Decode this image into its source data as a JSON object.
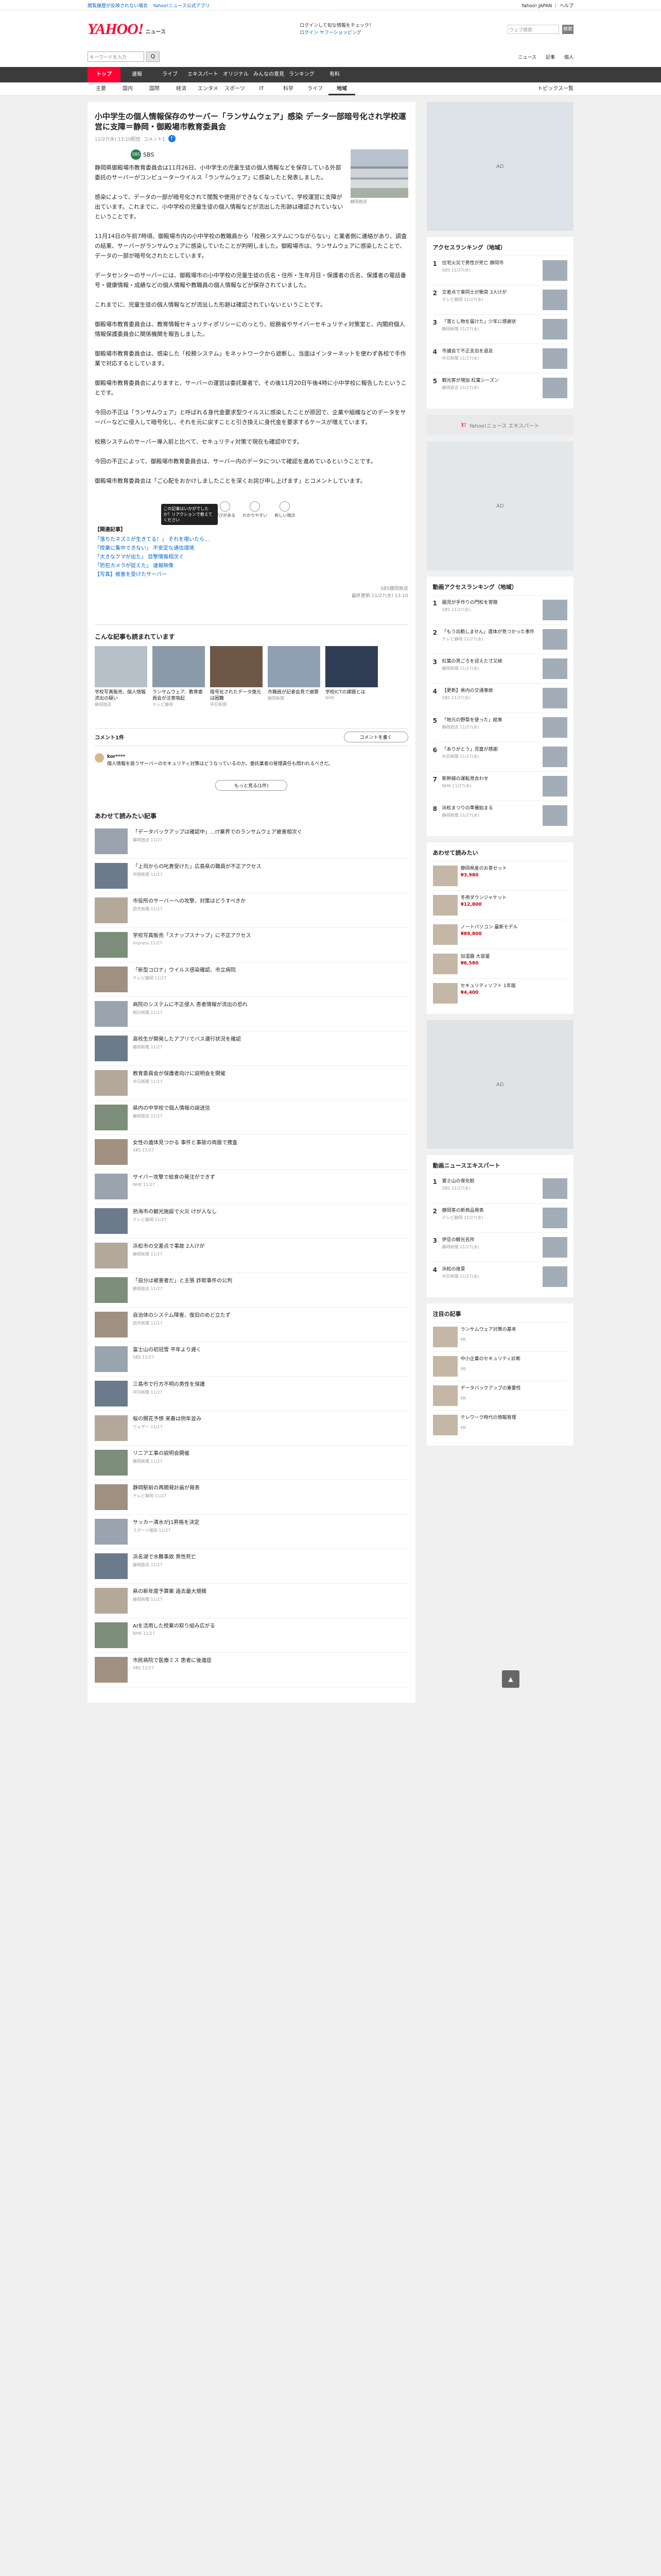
{
  "topbar": {
    "left1": "閲覧履歴が反映されない場合",
    "left2": "Yahoo!ニュース公式アプリ",
    "right1": "Yahoo! JAPAN",
    "right2": "ヘルプ"
  },
  "header": {
    "logo": "YAHOO!",
    "logo_sub": "JAPAN",
    "logo_news": "ニュース",
    "line1": "ログインして旬な情報をチェック！",
    "line2": "ログイン ヤフーショッピング",
    "search_placeholder": "ウェブ検索",
    "search_go": "検索"
  },
  "searchbar": {
    "placeholder": "キーワードを入力",
    "btn": "Q",
    "r1": "ニュース",
    "r2": "記事",
    "r3": "個人"
  },
  "nav1": [
    "トップ",
    "速報",
    "ライブ",
    "エキスパート",
    "オリジナル",
    "みんなの意見",
    "ランキング",
    "有料"
  ],
  "nav2": [
    "主要",
    "国内",
    "国際",
    "経済",
    "エンタメ",
    "スポーツ",
    "IT",
    "科学",
    "ライフ",
    "地域"
  ],
  "nav2_right": "トピックス一覧",
  "article": {
    "title": "小中学生の個人情報保存のサーバー「ランサムウェア」感染 データ一部暗号化され学校運営に支障＝静岡・御殿場市教育委員会",
    "date": "11/27(水) 13:10配信",
    "comments": "コメント1",
    "source": "SBS",
    "photo_caption": "静岡放送",
    "paragraphs": [
      "静岡県御殿場市教育委員会は11月26日、小中学生の児童生徒の個人情報などを保存している外部委託のサーバーがコンピューターウイルス「ランサムウェア」に感染したと発表しました。",
      "感染によって、データの一部が暗号化されて閲覧や使用ができなくなっていて、学校運営に支障が出ています。これまでに、小中学校の児童生徒の個人情報などが流出した形跡は確認されていないということです。",
      "11月14日の午前7時頃、御殿場市内の小中学校の教職員から「校務システムにつながらない」と業者側に連絡があり、調査の結果、サーバーがランサムウェアに感染していたことが判明しました。御殿場市は、ランサムウェアに感染したことで、データの一部が暗号化されたとしています。",
      "データセンターのサーバーには、御殿場市の小中学校の児童生徒の氏名・住所・生年月日・保護者の氏名、保護者の電話番号・健康情報・成績などの個人情報や教職員の個人情報などが保存されていました。",
      "これまでに、児童生徒の個人情報などが流出した形跡は確認されていないということです。",
      "御殿場市教育委員会は、教育情報セキュリティポリシーにのっとり、総務省やサイバーセキュリティ対策室と、内閣府個人情報保護委員会に関係機関を報告しました。",
      "御殿場市教育委員会は、感染した「校務システム」をネットワークから遮断し、当面はインターネットを使わず各校で手作業で対応するとしています。",
      "御殿場市教育委員会によりますと、サーバーの運営は委託業者で、その後11月20日午後4時に小中学校に報告したということです。",
      "今回の不正は「ランサムウェア」と呼ばれる身代金要求型ウイルスに感染したことが原因で、企業や組織などのデータをサーバーなどに侵入して暗号化し、それを元に戻すことと引き換えに身代金を要求するケースが増えています。",
      "校務システムのサーバー導入前と比べて、セキュリティ対策で現在も確認中です。",
      "今回の不正によって、御殿場市教育委員会は、サーバー内のデータについて確認を進めているということです。",
      "御殿場市教育委員会は「ご心配をおかけしましたことを深くお詫び申し上げます」とコメントしています。"
    ],
    "tooltip": "この記事はいかがでしたか？リアクションで教えてください",
    "reactions": [
      "学びがある",
      "わかりやすい",
      "新しい視点"
    ],
    "related_title": "【関連記事】",
    "related": [
      "「落ちたネズミが生きてる！」 それを覗いたら…",
      "「授業に集中できない」 不安定な通信環境",
      "「大きなクマが出た」 目撃情報相次ぐ",
      "「防犯カメラが捉えた」 速報映像",
      "【写真】被害を受けたサーバー"
    ],
    "updated": "最終更新:11/27(水) 13:10",
    "source_footer": "SBS静岡放送"
  },
  "also": {
    "title": "こんな記事も読まれています",
    "items": [
      {
        "t": "学校写真販売、個人情報流出の疑い",
        "s": "静岡放送"
      },
      {
        "t": "ランサムウェア、教育委員会が注意喚起",
        "s": "テレビ静岡"
      },
      {
        "t": "暗号化されたデータ復元は困難",
        "s": "中日新聞"
      },
      {
        "t": "市職員が記者会見で謝罪",
        "s": "静岡新聞"
      },
      {
        "t": "学校ICTの課題とは",
        "s": "NHK"
      }
    ]
  },
  "comment": {
    "label": "コメント1件",
    "write": "コメントを書く",
    "user": "kor****",
    "text": "個人情報を扱うサーバーのセキュリティ対策はどうなっているのか。委託業者の管理責任も問われるべきだ。",
    "more": "もっと見る(1件)"
  },
  "topics": {
    "title": "あわせて読みたい記事",
    "items": [
      {
        "t": "「データバックアップは確認中」…IT業界でのランサムウェア被害相次ぐ",
        "s": "静岡放送 11/27"
      },
      {
        "t": "「上司からの叱責受けた」広島県の職員が不正アクセス",
        "s": "中国新聞 11/27"
      },
      {
        "t": "市役所のサーバーへの攻撃、対策はどうすべきか",
        "s": "読売新聞 11/27"
      },
      {
        "t": "学校写真販売「スナップスナップ」に不正アクセス",
        "s": "Impress 11/27"
      },
      {
        "t": "「新型コロナ」ウイルス感染確認、市立病院",
        "s": "テレビ静岡 11/27"
      },
      {
        "t": "病院のシステムに不正侵入 患者情報が流出の恐れ",
        "s": "朝日新聞 11/27"
      },
      {
        "t": "高校生が開発したアプリでバス運行状況を確認",
        "s": "静岡新聞 11/27"
      },
      {
        "t": "教育委員会が保護者向けに説明会を開催",
        "s": "中日新聞 11/27"
      },
      {
        "t": "県内の中学校で個人情報の誤送信",
        "s": "静岡放送 11/27"
      },
      {
        "t": "女性の遺体見つかる 事件と事故の両面で捜査",
        "s": "SBS 11/27"
      },
      {
        "t": "サイバー攻撃で給食の発注ができず",
        "s": "NHK 11/27"
      },
      {
        "t": "熱海市の観光施設で火災 けが人なし",
        "s": "テレビ静岡 11/27"
      },
      {
        "t": "浜松市の交差点で事故 2人けが",
        "s": "静岡新聞 11/27"
      },
      {
        "t": "「自分は被害者だ」と主張 詐欺事件の公判",
        "s": "静岡放送 11/27"
      },
      {
        "t": "自治体のシステム障害、復旧のめど立たず",
        "s": "読売新聞 11/27"
      },
      {
        "t": "富士山の初冠雪 平年より遅く",
        "s": "SBS 11/27"
      },
      {
        "t": "三島市で行方不明の男性を保護",
        "s": "中日新聞 11/27"
      },
      {
        "t": "桜の開花予想 来春は例年並み",
        "s": "ウェザー 11/27"
      },
      {
        "t": "リニア工事の説明会開催",
        "s": "静岡新聞 11/27"
      },
      {
        "t": "静岡駅前の再開発計画が発表",
        "s": "テレビ静岡 11/27"
      },
      {
        "t": "サッカー清水がJ1昇格を決定",
        "s": "スポーツ報知 11/27"
      },
      {
        "t": "浜名湖で水難事故 男性死亡",
        "s": "静岡放送 11/27"
      },
      {
        "t": "県の新年度予算案 過去最大規模",
        "s": "静岡新聞 11/27"
      },
      {
        "t": "AIを活用した授業の取り組み広がる",
        "s": "NHK 11/27"
      },
      {
        "t": "市民病院で医療ミス 患者に後遺症",
        "s": "SBS 11/27"
      }
    ]
  },
  "side": {
    "access_title": "アクセスランキング（地域）",
    "access": [
      {
        "n": "1",
        "t": "住宅火災で男性が死亡 静岡市",
        "s": "SBS 11/27(水)"
      },
      {
        "n": "2",
        "t": "交差点で車同士が衝突 3人けが",
        "s": "テレビ静岡 11/27(水)"
      },
      {
        "n": "3",
        "t": "「落とし物を届けた」少年に感謝状",
        "s": "静岡新聞 11/27(水)"
      },
      {
        "n": "4",
        "t": "市議会で不正支出を追及",
        "s": "中日新聞 11/27(水)"
      },
      {
        "n": "5",
        "t": "観光客が増加 紅葉シーズン",
        "s": "静岡放送 11/27(水)"
      }
    ],
    "ad1": "Yahoo!ニュース エキスパート",
    "rank_title": "動画アクセスランキング（地域）",
    "rank": [
      {
        "n": "1",
        "t": "園児が手作りの門松を寄贈",
        "s": "SBS 11/27(水)"
      },
      {
        "n": "2",
        "t": "「もう出勤しません」遺体が見つかった事件",
        "s": "テレビ静岡 11/27(水)"
      },
      {
        "n": "3",
        "t": "紅葉の見ごろを迎えた寸又峡",
        "s": "静岡新聞 11/27(水)"
      },
      {
        "n": "4",
        "t": "【更新】県内の交通事故",
        "s": "SBS 11/27(水)"
      },
      {
        "n": "5",
        "t": "「地元の野菜を使った」給食",
        "s": "静岡放送 11/27(水)"
      },
      {
        "n": "6",
        "t": "「ありがとう」児童が感謝",
        "s": "中日新聞 11/27(水)"
      },
      {
        "n": "7",
        "t": "新幹線の運転見合わせ",
        "s": "NHK 11/27(水)"
      },
      {
        "n": "8",
        "t": "浜松まつりの準備始まる",
        "s": "静岡新聞 11/27(水)"
      }
    ],
    "shop_title": "あわせて読みたい",
    "shop": [
      {
        "t": "静岡県産のお茶セット",
        "p": "¥3,980"
      },
      {
        "t": "冬用ダウンジャケット",
        "p": "¥12,800"
      },
      {
        "t": "ノートパソコン 最新モデル",
        "p": "¥89,800"
      },
      {
        "t": "加湿器 大容量",
        "p": "¥6,580"
      },
      {
        "t": "セキュリティソフト 1年版",
        "p": "¥4,400"
      }
    ],
    "news_title": "動画ニュースエキスパート",
    "news": [
      {
        "n": "1",
        "t": "富士山の雪化粧",
        "s": "SBS 11/27(水)"
      },
      {
        "n": "2",
        "t": "静岡茶の新商品発表",
        "s": "テレビ静岡 11/27(水)"
      },
      {
        "n": "3",
        "t": "伊豆の観光名所",
        "s": "静岡新聞 11/27(水)"
      },
      {
        "n": "4",
        "t": "浜松の夜景",
        "s": "中日新聞 11/27(水)"
      }
    ],
    "pr_title": "注目の記事",
    "pr": [
      {
        "t": "ランサムウェア対策の基本",
        "s": "PR"
      },
      {
        "t": "中小企業のセキュリティ診断",
        "s": "PR"
      },
      {
        "t": "データバックアップの重要性",
        "s": "PR"
      },
      {
        "t": "テレワーク時代の情報管理",
        "s": "PR"
      }
    ]
  },
  "pagetop": "▲"
}
